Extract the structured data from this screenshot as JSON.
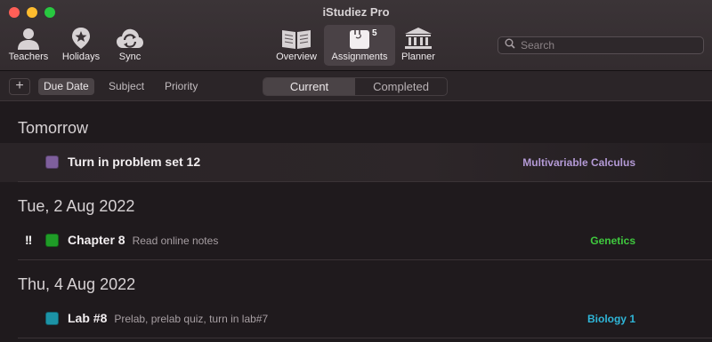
{
  "window": {
    "title": "iStudiez Pro"
  },
  "toolbar": {
    "teachers_label": "Teachers",
    "holidays_label": "Holidays",
    "sync_label": "Sync",
    "overview_label": "Overview",
    "assignments_label": "Assignments",
    "assignments_badge": "5",
    "planner_label": "Planner",
    "active": "Assignments"
  },
  "search": {
    "placeholder": "Search",
    "value": ""
  },
  "sortbar": {
    "add_label": "+",
    "due_date_label": "Due Date",
    "subject_label": "Subject",
    "priority_label": "Priority",
    "active_sort": "Due Date"
  },
  "segments": {
    "current_label": "Current",
    "completed_label": "Completed",
    "active": "Current"
  },
  "groups": [
    {
      "header": "Tomorrow",
      "items": [
        {
          "title": "Turn in problem set 12",
          "note": "",
          "priority": "",
          "subject": "Multivariable Calculus",
          "color": "#7e5f9c",
          "subject_color": "#b49ad6",
          "selected": true
        }
      ]
    },
    {
      "header": "Tue, 2 Aug 2022",
      "items": [
        {
          "title": "Chapter 8",
          "note": "Read online notes",
          "priority": "!!",
          "subject": "Genetics",
          "color": "#1f9c27",
          "subject_color": "#3fc93e",
          "selected": false
        }
      ]
    },
    {
      "header": "Thu, 4 Aug 2022",
      "items": [
        {
          "title": "Lab #8",
          "note": "Prelab, prelab quiz, turn in lab#7",
          "priority": "",
          "subject": "Biology 1",
          "color": "#1c93a6",
          "subject_color": "#2fb6d8",
          "selected": false
        }
      ]
    }
  ]
}
